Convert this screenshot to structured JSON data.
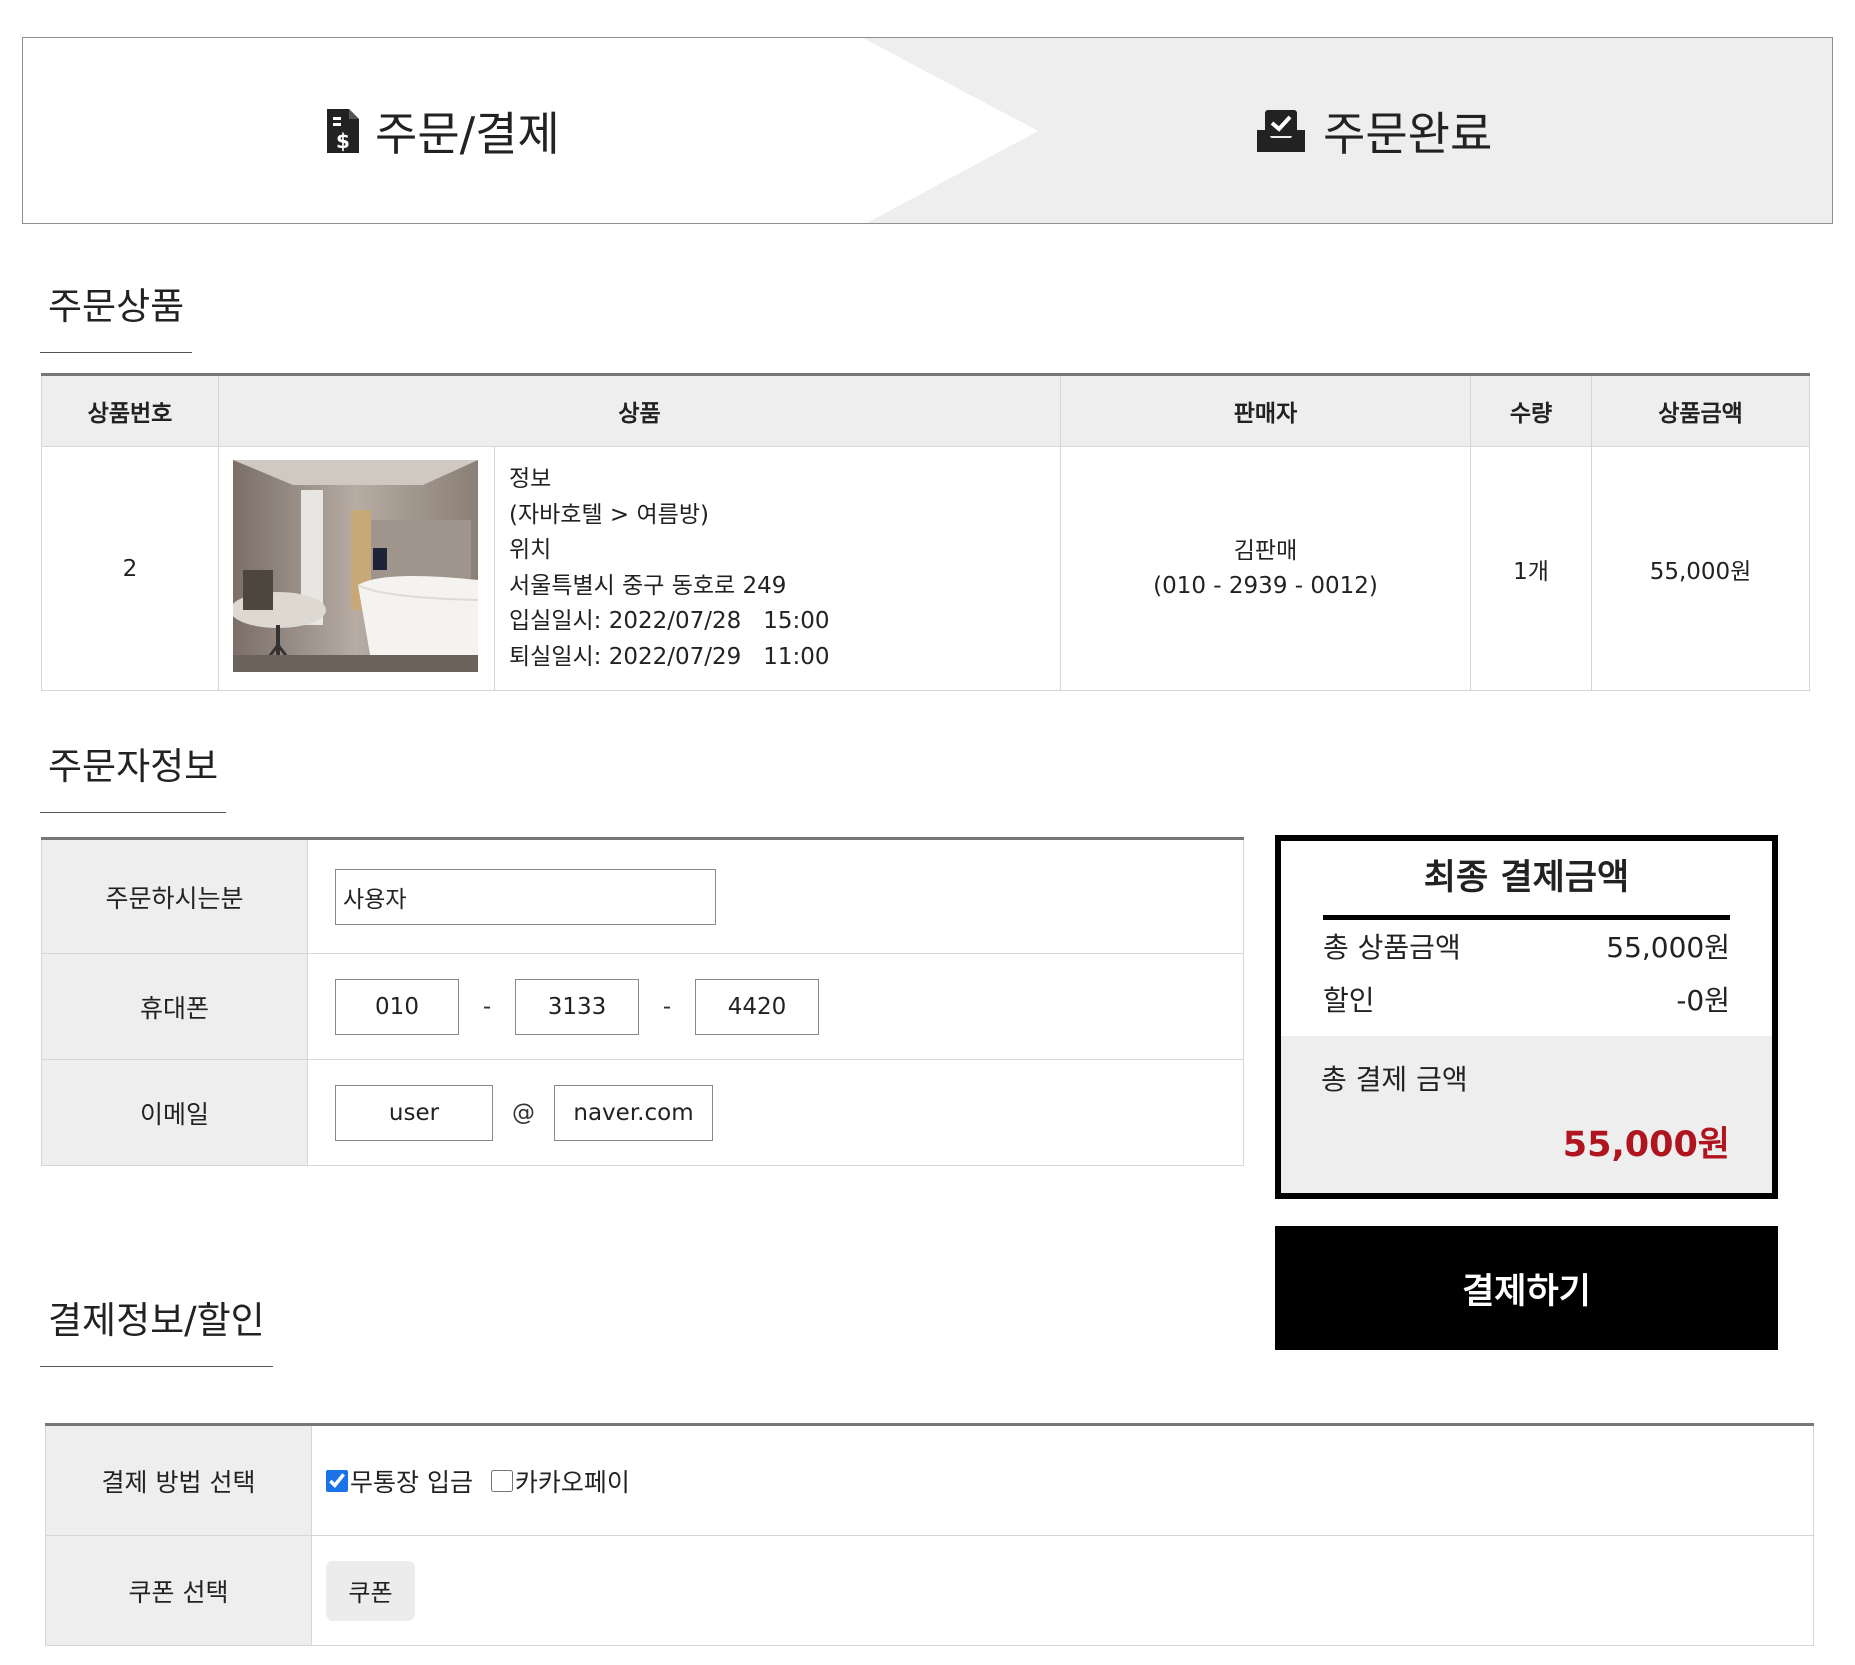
{
  "steps": {
    "step1": {
      "label": "주문/결제",
      "icon": "receipt-dollar-icon"
    },
    "step2": {
      "label": "주문완료",
      "icon": "inbox-check-icon"
    }
  },
  "order_items": {
    "title": "주문상품",
    "headers": [
      "상품번호",
      "상품",
      "판매자",
      "수량",
      "상품금액"
    ],
    "rows": [
      {
        "number": "2",
        "image": "hotel-room-photo",
        "info": [
          "정보",
          "(자바호텔 > 여름방)",
          "위치",
          "서울특별시 중구 동호로 249",
          "입실일시: 2022/07/28   15:00",
          "퇴실일시: 2022/07/29   11:00"
        ],
        "seller_name": "김판매",
        "seller_phone": "(010 - 2939 - 0012)",
        "quantity": "1개",
        "price": "55,000원"
      }
    ]
  },
  "buyer": {
    "title": "주문자정보",
    "name_label": "주문하시는분",
    "name_value": "사용자",
    "phone_label": "휴대폰",
    "phone": [
      "010",
      "3133",
      "4420"
    ],
    "phone_sep": "-",
    "email_label": "이메일",
    "email_user": "user",
    "email_at": "@",
    "email_domain": "naver.com"
  },
  "summary": {
    "title": "최종 결제금액",
    "total_products_label": "총 상품금액",
    "total_products_value": "55,000원",
    "discount_label": "할인",
    "discount_value": "-0원",
    "grand_total_label": "총 결제 금액",
    "grand_total_value": "55,000원",
    "grand_total_color": "#b0141e"
  },
  "pay_button_label": "결제하기",
  "payment": {
    "title": "결제정보/할인",
    "method_label": "결제 방법 선택",
    "methods": [
      {
        "label": "무통장 입금",
        "checked": true
      },
      {
        "label": "카카오페이",
        "checked": false
      }
    ],
    "coupon_label": "쿠폰 선택",
    "coupon_button": "쿠폰"
  }
}
